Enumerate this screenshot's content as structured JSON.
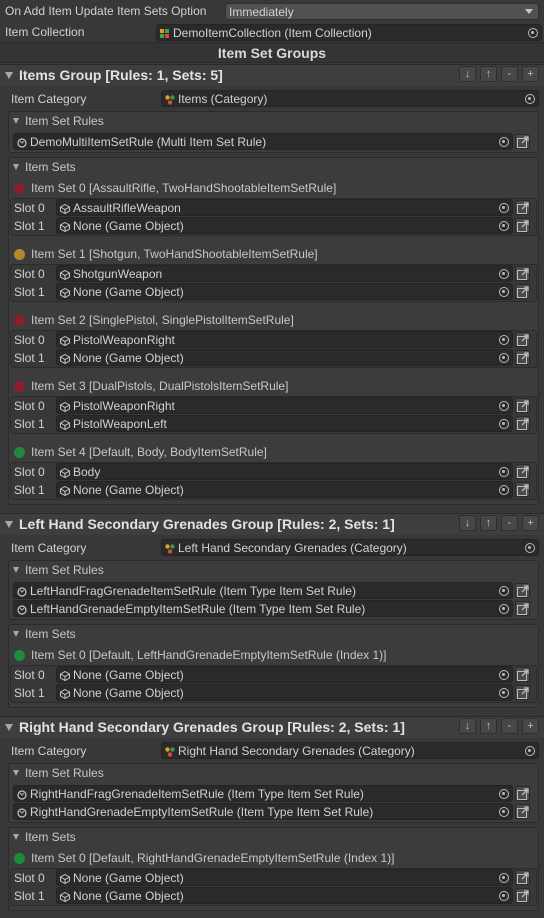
{
  "top": {
    "on_add_label": "On Add Item Update Item Sets Option",
    "on_add_value": "Immediately",
    "item_collection_label": "Item Collection",
    "item_collection_value": "DemoItemCollection (Item Collection)",
    "groups_title": "Item Set Groups"
  },
  "colors": {
    "red": "#8a1f2e",
    "yellow": "#b08a2a",
    "green": "#1f8a3a"
  },
  "groups": [
    {
      "title": "Items Group [Rules: 1, Sets: 5]",
      "category_label": "Item Category",
      "category_value": "Items (Category)",
      "rules_label": "Item Set Rules",
      "rules": [
        "DemoMultiItemSetRule (Multi Item Set Rule)"
      ],
      "sets_label": "Item Sets",
      "sets": [
        {
          "title": "Item Set 0 [AssaultRifle, TwoHandShootableItemSetRule]",
          "color": "red",
          "slots": [
            {
              "label": "Slot 0",
              "value": "AssaultRifleWeapon"
            },
            {
              "label": "Slot 1",
              "value": "None (Game Object)"
            }
          ]
        },
        {
          "title": "Item Set 1 [Shotgun, TwoHandShootableItemSetRule]",
          "color": "yellow",
          "slots": [
            {
              "label": "Slot 0",
              "value": "ShotgunWeapon"
            },
            {
              "label": "Slot 1",
              "value": "None (Game Object)"
            }
          ]
        },
        {
          "title": "Item Set 2 [SinglePistol, SinglePistolItemSetRule]",
          "color": "red",
          "slots": [
            {
              "label": "Slot 0",
              "value": "PistolWeaponRight"
            },
            {
              "label": "Slot 1",
              "value": "None (Game Object)"
            }
          ]
        },
        {
          "title": "Item Set 3 [DualPistols, DualPistolsItemSetRule]",
          "color": "red",
          "slots": [
            {
              "label": "Slot 0",
              "value": "PistolWeaponRight"
            },
            {
              "label": "Slot 1",
              "value": "PistolWeaponLeft"
            }
          ]
        },
        {
          "title": "Item Set 4 [Default, Body, BodyItemSetRule]",
          "color": "green",
          "slots": [
            {
              "label": "Slot 0",
              "value": "Body"
            },
            {
              "label": "Slot 1",
              "value": "None (Game Object)"
            }
          ]
        }
      ]
    },
    {
      "title": "Left Hand Secondary Grenades Group [Rules: 2, Sets: 1]",
      "category_label": "Item Category",
      "category_value": "Left Hand Secondary Grenades (Category)",
      "rules_label": "Item Set Rules",
      "rules": [
        "LeftHandFragGrenadeItemSetRule (Item Type Item Set Rule)",
        "LeftHandGrenadeEmptyItemSetRule (Item Type Item Set Rule)"
      ],
      "sets_label": "Item Sets",
      "sets": [
        {
          "title": "Item Set 0 [Default, LeftHandGrenadeEmptyItemSetRule (Index 1)]",
          "color": "green",
          "slots": [
            {
              "label": "Slot 0",
              "value": "None (Game Object)"
            },
            {
              "label": "Slot 1",
              "value": "None (Game Object)"
            }
          ]
        }
      ]
    },
    {
      "title": "Right Hand Secondary Grenades Group [Rules: 2, Sets: 1]",
      "category_label": "Item Category",
      "category_value": "Right Hand Secondary Grenades (Category)",
      "rules_label": "Item Set Rules",
      "rules": [
        "RightHandFragGrenadeItemSetRule (Item Type Item Set Rule)",
        "RightHandGrenadeEmptyItemSetRule (Item Type Item Set Rule)"
      ],
      "sets_label": "Item Sets",
      "sets": [
        {
          "title": "Item Set 0 [Default, RightHandGrenadeEmptyItemSetRule (Index 1)]",
          "color": "green",
          "slots": [
            {
              "label": "Slot 0",
              "value": "None (Game Object)"
            },
            {
              "label": "Slot 1",
              "value": "None (Game Object)"
            }
          ]
        }
      ]
    }
  ],
  "header_buttons": [
    "↓",
    "↑",
    "-",
    "+"
  ]
}
